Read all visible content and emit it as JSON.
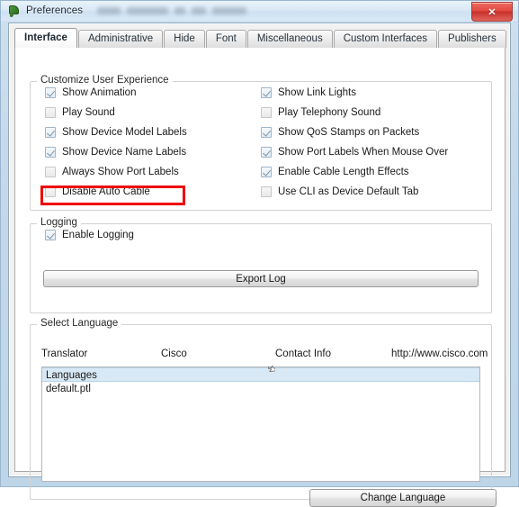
{
  "window": {
    "title": "Preferences",
    "app_icon": "packet-tracer-icon",
    "close_label": "✕",
    "redacted_title_present": true
  },
  "tabs": [
    {
      "label": "Interface",
      "active": true
    },
    {
      "label": "Administrative",
      "active": false
    },
    {
      "label": "Hide",
      "active": false
    },
    {
      "label": "Font",
      "active": false
    },
    {
      "label": "Miscellaneous",
      "active": false
    },
    {
      "label": "Custom Interfaces",
      "active": false
    },
    {
      "label": "Publishers",
      "active": false
    }
  ],
  "customize": {
    "legend": "Customize User Experience",
    "left_column": [
      {
        "label": "Show Animation",
        "checked": true,
        "highlighted": false
      },
      {
        "label": "Play Sound",
        "checked": false,
        "highlighted": false
      },
      {
        "label": "Show Device Model Labels",
        "checked": true,
        "highlighted": false
      },
      {
        "label": "Show Device Name Labels",
        "checked": true,
        "highlighted": false
      },
      {
        "label": "Always Show Port Labels",
        "checked": false,
        "highlighted": true
      },
      {
        "label": "Disable Auto Cable",
        "checked": false,
        "highlighted": false
      }
    ],
    "right_column": [
      {
        "label": "Show Link Lights",
        "checked": true
      },
      {
        "label": "Play Telephony Sound",
        "checked": false
      },
      {
        "label": "Show QoS Stamps on Packets",
        "checked": true
      },
      {
        "label": "Show Port Labels When Mouse Over",
        "checked": true
      },
      {
        "label": "Enable Cable Length Effects",
        "checked": true
      },
      {
        "label": "Use CLI as Device Default Tab",
        "checked": false
      }
    ]
  },
  "logging": {
    "legend": "Logging",
    "enable_label": "Enable Logging",
    "enable_checked": true,
    "export_label": "Export Log"
  },
  "language": {
    "legend": "Select Language",
    "headers": [
      "Translator",
      "Cisco",
      "Contact Info",
      "http://www.cisco.com"
    ],
    "rows": [
      {
        "label": "Languages",
        "selected": true
      },
      {
        "label": "default.ptl",
        "selected": false
      }
    ],
    "change_label": "Change Language"
  },
  "colors": {
    "annotation": "#ee0000",
    "selection": "#d8e8f5",
    "titlebar": "#dbe9f6",
    "close_button": "#d94a40"
  }
}
